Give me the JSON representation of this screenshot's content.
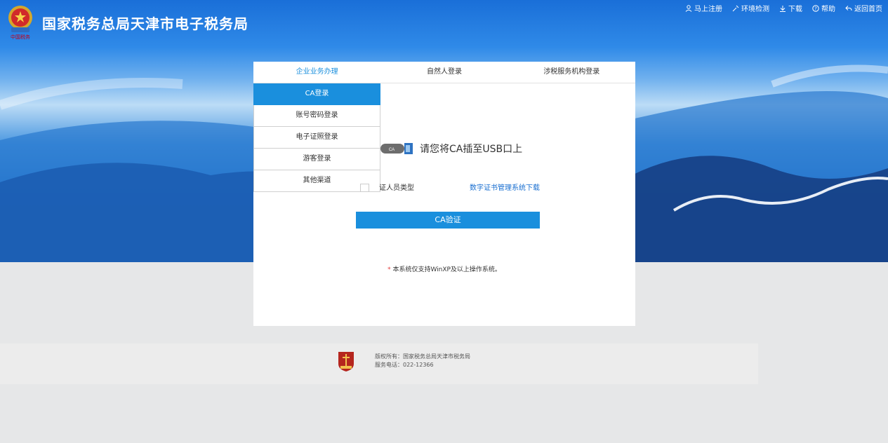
{
  "header": {
    "title": "国家税务总局天津市电子税务局",
    "emblem_caption": "中国税务",
    "nav": [
      {
        "label": "马上注册",
        "icon": "user-icon"
      },
      {
        "label": "环境检测",
        "icon": "tools-icon"
      },
      {
        "label": "下载",
        "icon": "download-icon"
      },
      {
        "label": "帮助",
        "icon": "help-icon"
      },
      {
        "label": "返回首页",
        "icon": "return-icon"
      }
    ]
  },
  "login": {
    "tabs": [
      "企业业务办理",
      "自然人登录",
      "涉税服务机构登录"
    ],
    "active_tab": "企业业务办理",
    "menu": [
      "CA登录",
      "账号密码登录",
      "电子证照登录",
      "游客登录",
      "其他渠道"
    ],
    "active_menu": "CA登录",
    "usb_badge": "CA",
    "usb_prompt": "请您将CA插至USB口上",
    "cert_type_label": "证人员类型",
    "download_link": "数字证书管理系统下载",
    "verify_button": "CA验证",
    "note_star": "*",
    "note": "本系统仅支持WinXP及以上操作系统。"
  },
  "footer": {
    "copyright": "版权所有：国家税务总局天津市税务局",
    "phone": "服务电话：022-12366"
  },
  "colors": {
    "accent": "#1a8fdd",
    "link": "#1a6fd0",
    "required_star": "#e23b3b",
    "brand_red": "#c2001b"
  }
}
